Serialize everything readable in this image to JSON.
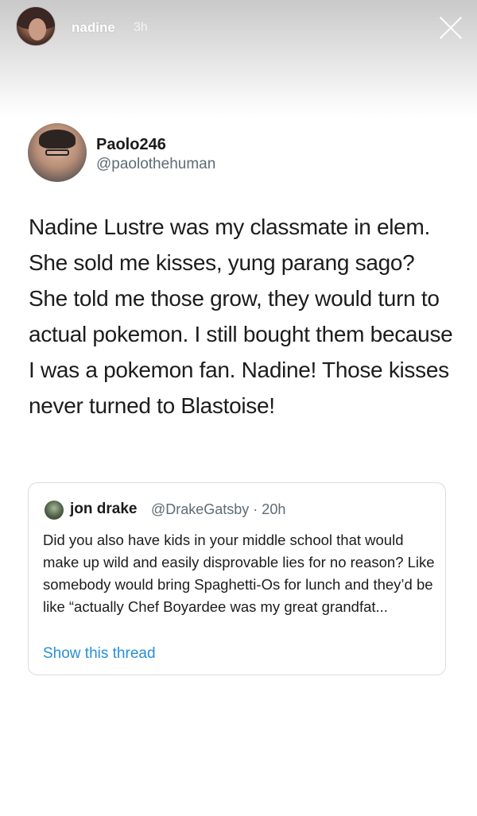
{
  "story": {
    "username": "nadine",
    "time": "3h"
  },
  "tweet": {
    "display_name": "Paolo246",
    "handle": "@paolothehuman",
    "text": "Nadine Lustre was my classmate in elem. She sold me kisses, yung parang sago? She told me those grow, they would turn to actual pokemon. I still bought them because I was a pokemon fan. Nadine! Those kisses never turned to Blastoise!"
  },
  "quoted_tweet": {
    "display_name": "jon drake",
    "handle_and_time": "@DrakeGatsby · 20h",
    "text": "Did you also have kids in your middle school that would make up wild and easily disprovable lies for no reason? Like somebody would bring Spaghetti-Os for lunch and they’d be like “actually Chef Boyardee was my great grandfat...",
    "show_thread": "Show this thread"
  },
  "icons": {
    "close": "close-icon"
  },
  "colors": {
    "link": "#2a8ed6",
    "handle": "#5f6b75"
  }
}
